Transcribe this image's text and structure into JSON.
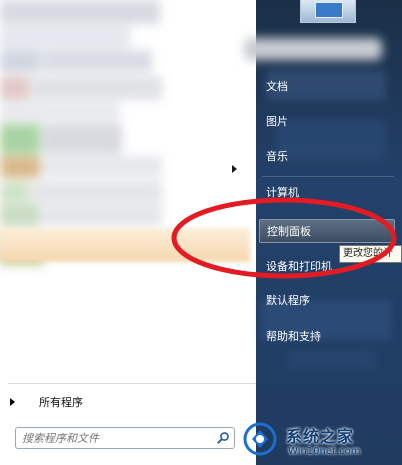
{
  "left_pane": {
    "all_programs_label": "所有程序",
    "search_placeholder": "搜索程序和文件"
  },
  "right_pane": {
    "items": [
      {
        "label": "文档"
      },
      {
        "label": "图片"
      },
      {
        "label": "音乐"
      },
      {
        "label": "计算机"
      },
      {
        "label": "控制面板"
      },
      {
        "label": "设备和打印机"
      },
      {
        "label": "默认程序"
      },
      {
        "label": "帮助和支持"
      }
    ],
    "active_item": "控制面板",
    "tooltip_text": "更改您的计"
  },
  "watermark": {
    "brand": "系统之家",
    "url": "Win10net.com"
  },
  "annotation": {
    "color": "#e31b23",
    "shape": "ellipse",
    "target": "控制面板"
  },
  "icons": [
    "arrow-right-icon",
    "triangle-right-icon",
    "search-icon",
    "user-picture-icon",
    "watermark-logo-icon"
  ]
}
